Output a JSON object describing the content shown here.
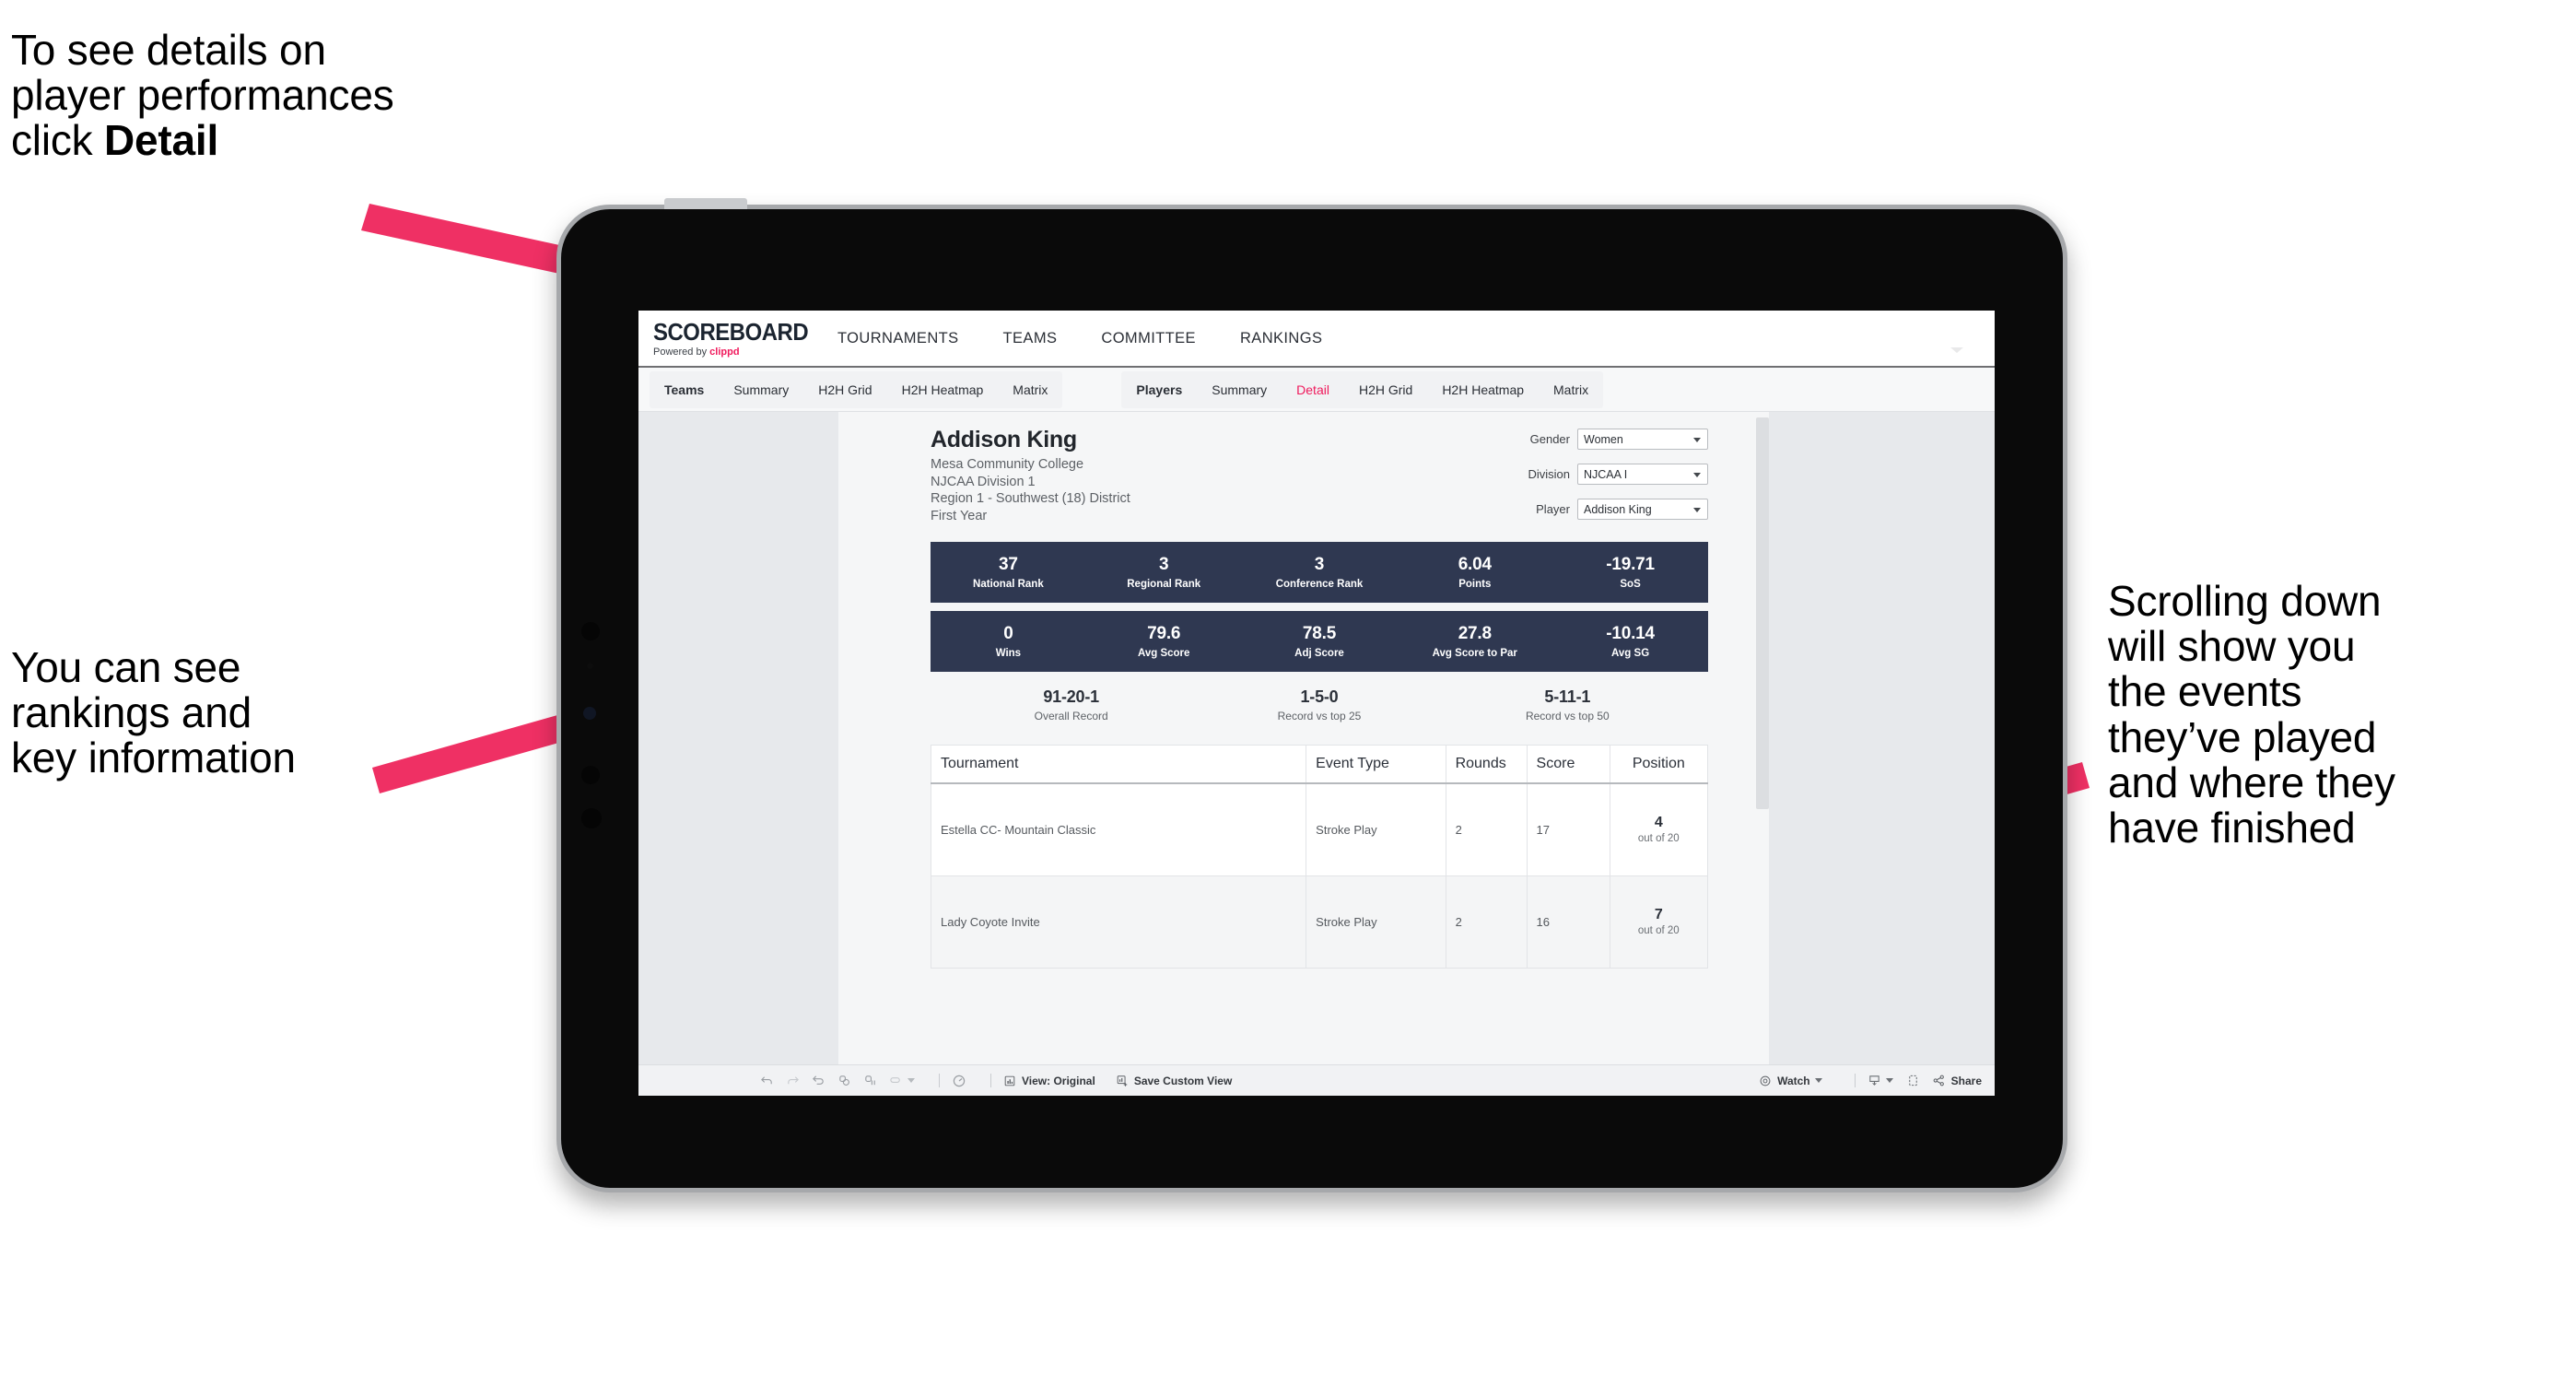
{
  "annotations": {
    "detail_note": "To see details on\nplayer performances\nclick ",
    "detail_note_bold": "Detail",
    "rankings_note": "You can see\nrankings and\nkey information",
    "scroll_note": "Scrolling down\nwill show you\nthe events\nthey’ve played\nand where they\nhave finished",
    "arrow_color": "#ef3064"
  },
  "app": {
    "brand": {
      "logo": "SCOREBOARD",
      "powered_prefix": "Powered by ",
      "powered_name": "clippd"
    },
    "topnav": [
      "TOURNAMENTS",
      "TEAMS",
      "COMMITTEE",
      "RANKINGS"
    ],
    "tabs_teams": [
      "Teams",
      "Summary",
      "H2H Grid",
      "H2H Heatmap",
      "Matrix"
    ],
    "tabs_players": [
      "Players",
      "Summary",
      "Detail",
      "H2H Grid",
      "H2H Heatmap",
      "Matrix"
    ],
    "active_tab": "Detail",
    "accent": "#f0195c"
  },
  "player": {
    "name": "Addison King",
    "school": "Mesa Community College",
    "division": "NJCAA Division 1",
    "region": "Region 1 - Southwest (18) District",
    "year": "First Year"
  },
  "filters": [
    {
      "label": "Gender",
      "value": "Women"
    },
    {
      "label": "Division",
      "value": "NJCAA I"
    },
    {
      "label": "Player",
      "value": "Addison King"
    }
  ],
  "stats_row1": [
    {
      "value": "37",
      "label": "National Rank"
    },
    {
      "value": "3",
      "label": "Regional Rank"
    },
    {
      "value": "3",
      "label": "Conference Rank"
    },
    {
      "value": "6.04",
      "label": "Points"
    },
    {
      "value": "-19.71",
      "label": "SoS"
    }
  ],
  "stats_row2": [
    {
      "value": "0",
      "label": "Wins"
    },
    {
      "value": "79.6",
      "label": "Avg Score"
    },
    {
      "value": "78.5",
      "label": "Adj Score"
    },
    {
      "value": "27.8",
      "label": "Avg Score to Par"
    },
    {
      "value": "-10.14",
      "label": "Avg SG"
    }
  ],
  "records": [
    {
      "value": "91-20-1",
      "label": "Overall Record"
    },
    {
      "value": "1-5-0",
      "label": "Record vs top 25"
    },
    {
      "value": "5-11-1",
      "label": "Record vs top 50"
    }
  ],
  "table": {
    "headers": [
      "Tournament",
      "Event Type",
      "Rounds",
      "Score",
      "Position"
    ],
    "rows": [
      {
        "tournament": "Estella CC- Mountain Classic",
        "event_type": "Stroke Play",
        "rounds": "2",
        "score": "17",
        "position": "4",
        "position_of": "out of 20"
      },
      {
        "tournament": "Lady Coyote Invite",
        "event_type": "Stroke Play",
        "rounds": "2",
        "score": "16",
        "position": "7",
        "position_of": "out of 20"
      }
    ]
  },
  "toolbar": {
    "view_label": "View: Original",
    "save_label": "Save Custom View",
    "watch_label": "Watch",
    "share_label": "Share"
  }
}
